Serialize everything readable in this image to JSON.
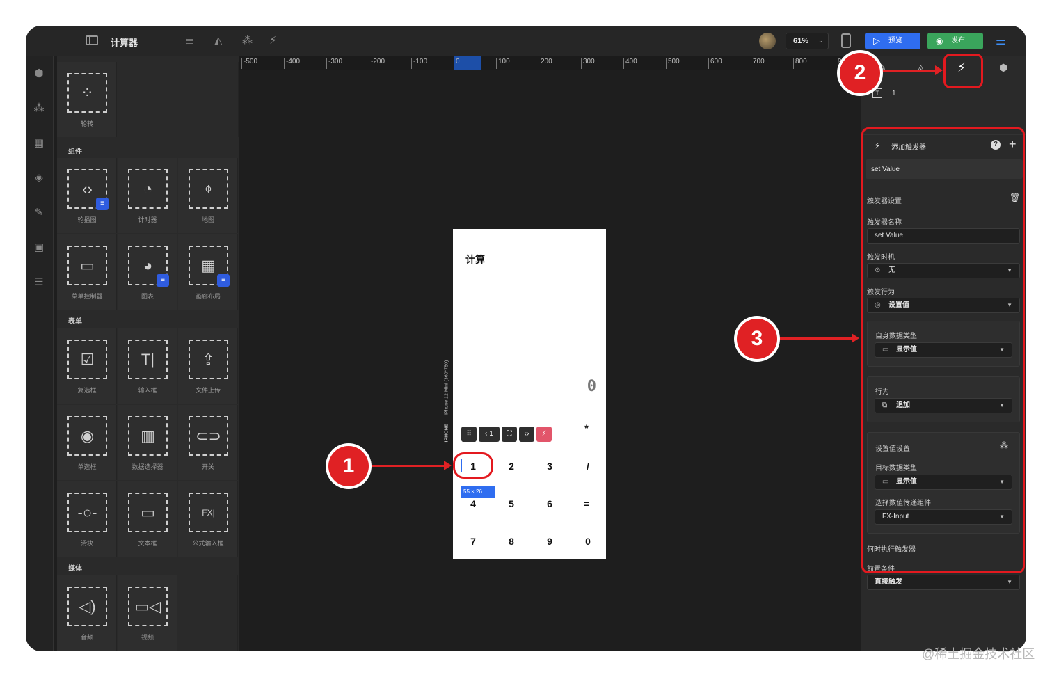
{
  "app": {
    "title": "计算器",
    "zoom": "61%",
    "preview_label": "预览",
    "publish_label": "发布",
    "watermark": "@稀土掘金技术社区"
  },
  "ruler": {
    "ticks": [
      "-500",
      "-400",
      "-300",
      "-200",
      "-100",
      "0",
      "100",
      "200",
      "300",
      "400",
      "500",
      "600",
      "700",
      "800",
      "9"
    ]
  },
  "library": {
    "top_item": "轮转",
    "sections": {
      "components": "组件",
      "form": "表单",
      "media": "媒体"
    },
    "components": [
      "轮播图",
      "计时器",
      "地图",
      "菜单控制器",
      "图表",
      "画廊布局"
    ],
    "form": [
      "复选框",
      "输入框",
      "文件上传",
      "单选框",
      "数据选择器",
      "开关",
      "滑块",
      "文本框",
      "公式输入框"
    ],
    "media": [
      "音频",
      "视频"
    ]
  },
  "phone": {
    "title": "计算",
    "display": "0",
    "device_label": "iPhone 12 Mini (360*780)",
    "device_type": "IPHONE",
    "size_badge": "55 × 26",
    "keys": {
      "op_star": "*",
      "row1": [
        "1",
        "2",
        "3",
        "/"
      ],
      "row2": [
        "4",
        "5",
        "6",
        "="
      ],
      "row3": [
        "7",
        "8",
        "9",
        "0"
      ]
    }
  },
  "inspector": {
    "layer_index": "1",
    "add_trigger": "添加触发器",
    "card_title": "set Value",
    "trigger_settings": "触发器设置",
    "trigger_name_label": "触发器名称",
    "trigger_name_value": "set Value",
    "trigger_timing_label": "触发时机",
    "trigger_timing_value": "无",
    "trigger_action_label": "触发行为",
    "trigger_action_value": "设置值",
    "self_data_type_label": "自身数据类型",
    "self_data_type_value": "显示值",
    "behavior_label": "行为",
    "behavior_value": "追加",
    "set_value_settings": "设置值设置",
    "target_data_type_label": "目标数据类型",
    "target_data_type_value": "显示值",
    "pass_component_label": "选择数值传递组件",
    "pass_component_value": "FX-Input",
    "when_execute_label": "何时执行触发器",
    "precondition_label": "前置条件",
    "precondition_value": "直接触发"
  },
  "callouts": [
    "1",
    "2",
    "3"
  ],
  "colors": {
    "accent_red": "#e02124",
    "preview_blue": "#2f6df0",
    "publish_green": "#3aa55c"
  }
}
